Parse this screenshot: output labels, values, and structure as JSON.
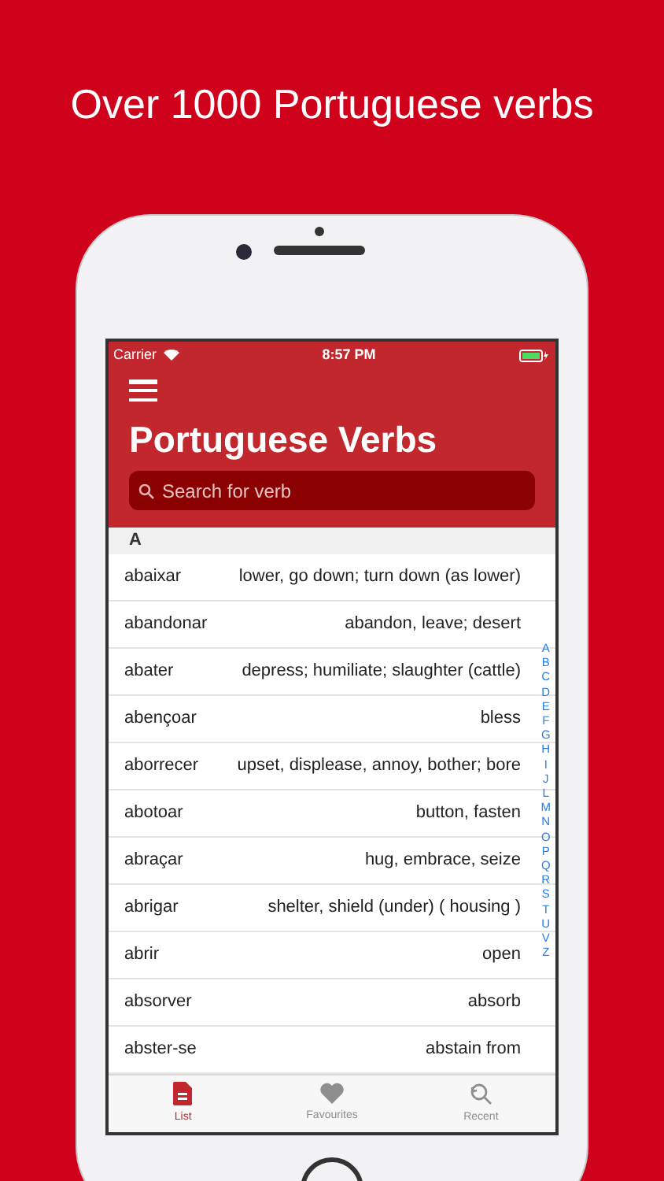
{
  "headline": "Over 1000 Portuguese verbs",
  "status_bar": {
    "carrier": "Carrier",
    "time": "8:57 PM"
  },
  "nav": {
    "title": "Portuguese Verbs"
  },
  "search": {
    "placeholder": "Search for verb"
  },
  "section": {
    "header": "A"
  },
  "rows": [
    {
      "verb": "abaixar",
      "meaning": "lower, go down; turn down (as lower)"
    },
    {
      "verb": "abandonar",
      "meaning": "abandon, leave; desert"
    },
    {
      "verb": "abater",
      "meaning": "depress; humiliate; slaughter (cattle)"
    },
    {
      "verb": "abençoar",
      "meaning": "bless"
    },
    {
      "verb": "aborrecer",
      "meaning": "upset, displease, annoy, bother; bore"
    },
    {
      "verb": "abotoar",
      "meaning": "button, fasten"
    },
    {
      "verb": "abraçar",
      "meaning": "hug, embrace, seize"
    },
    {
      "verb": "abrigar",
      "meaning": "shelter, shield (under) ( housing )"
    },
    {
      "verb": "abrir",
      "meaning": "open"
    },
    {
      "verb": "absorver",
      "meaning": "absorb"
    },
    {
      "verb": "abster-se",
      "meaning": "abstain from"
    }
  ],
  "index": [
    "A",
    "B",
    "C",
    "D",
    "E",
    "F",
    "G",
    "H",
    "I",
    "J",
    "L",
    "M",
    "N",
    "O",
    "P",
    "Q",
    "R",
    "S",
    "T",
    "U",
    "V",
    "Z"
  ],
  "tabs": [
    {
      "label": "List",
      "kind": "list",
      "selected": true
    },
    {
      "label": "Favourites",
      "kind": "heart",
      "selected": false
    },
    {
      "label": "Recent",
      "kind": "recent",
      "selected": false
    }
  ]
}
